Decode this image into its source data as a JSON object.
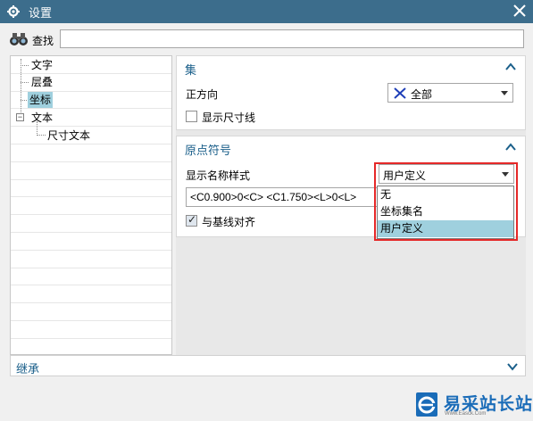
{
  "window": {
    "title": "设置"
  },
  "find": {
    "label": "查找",
    "value": ""
  },
  "tree": {
    "items": [
      {
        "label": "文字"
      },
      {
        "label": "层叠"
      },
      {
        "label": "坐标",
        "selected": true
      },
      {
        "label": "文本",
        "expander": "−"
      },
      {
        "label": "尺寸文本"
      }
    ]
  },
  "sections": {
    "set": {
      "title": "集",
      "orientation_label": "正方向",
      "orientation_value": "全部",
      "show_dimension_lines": "显示尺寸线",
      "show_dimension_lines_checked": false
    },
    "origin": {
      "title": "原点符号",
      "name_style_label": "显示名称样式",
      "name_style_value": "用户定义",
      "format_text": "<C0.900>0<C>  <C1.750><L>0<L>",
      "align_baseline": "与基线对齐",
      "align_baseline_checked": true
    }
  },
  "dropdown": {
    "options": [
      "无",
      "坐标集名",
      "用户定义"
    ],
    "selected": "用户定义"
  },
  "inherit": {
    "title": "继承"
  },
  "watermark": {
    "text": "易采站长站",
    "sub": "Www.Easck.Com"
  },
  "colors": {
    "titlebar": "#3c6d8c",
    "accent": "#1a5f8a",
    "selection": "#9fd0de",
    "highlight": "#e52828"
  }
}
